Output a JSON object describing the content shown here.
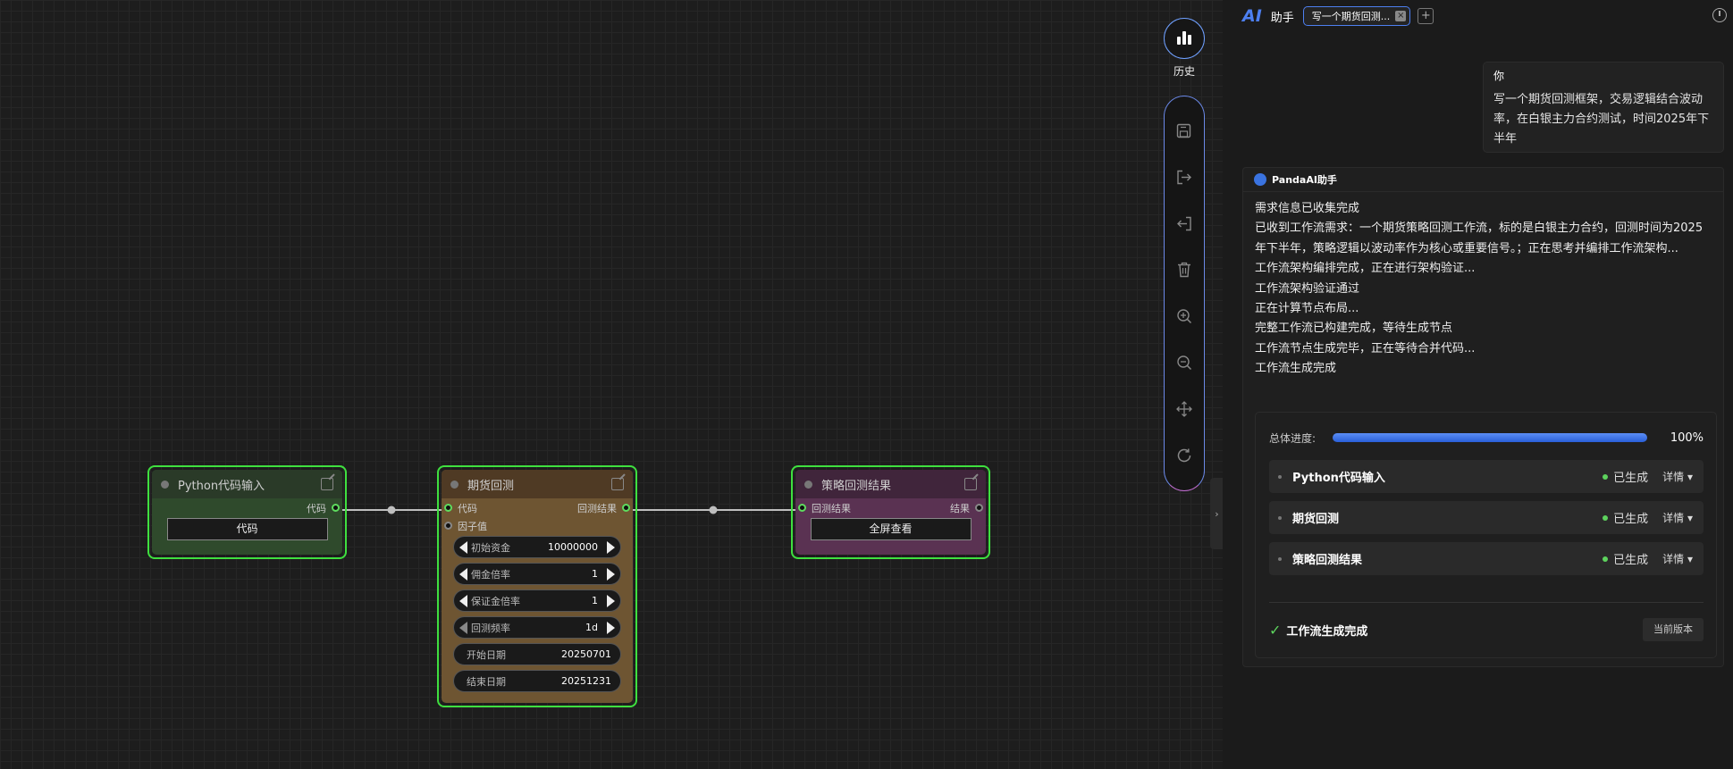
{
  "toolbar": {
    "history_label": "历史",
    "tools": [
      "save-icon",
      "export-icon",
      "import-icon",
      "delete-icon",
      "zoom-in-icon",
      "zoom-out-icon",
      "move-icon",
      "refresh-icon"
    ],
    "collapse_glyph": "›"
  },
  "nodes": {
    "python": {
      "title": "Python代码输入",
      "out_label": "代码",
      "button": "代码"
    },
    "backtest": {
      "title": "期货回测",
      "in_code": "代码",
      "in_factor": "因子值",
      "out_label": "回测结果",
      "params": [
        {
          "name": "初始资金",
          "value": "10000000"
        },
        {
          "name": "佣金倍率",
          "value": "1"
        },
        {
          "name": "保证金倍率",
          "value": "1"
        },
        {
          "name": "回测频率",
          "value": "1d"
        }
      ],
      "dates": [
        {
          "name": "开始日期",
          "value": "20250701"
        },
        {
          "name": "结束日期",
          "value": "20251231"
        }
      ]
    },
    "result": {
      "title": "策略回测结果",
      "in_label": "回测结果",
      "out_label": "结果",
      "button": "全屏查看"
    }
  },
  "panel": {
    "logo": "AI",
    "name": "助手",
    "tab_label": "写一个期货回测...",
    "tab_close": "×",
    "tab_add": "+",
    "user": {
      "who": "你",
      "message": "写一个期货回测框架，交易逻辑结合波动率，在白银主力合约测试，时间2025年下半年"
    },
    "bot": {
      "name": "PandaAI助手",
      "lines": [
        "需求信息已收集完成",
        "已收到工作流需求：一个期货策略回测工作流，标的是白银主力合约，回测时间为2025年下半年，策略逻辑以波动率作为核心或重要信号。；正在思考并编排工作流架构...",
        "工作流架构编排完成，正在进行架构验证...",
        "工作流架构验证通过",
        "正在计算节点布局...",
        "完整工作流已构建完成，等待生成节点",
        "工作流节点生成完毕，正在等待合并代码...",
        "工作流生成完成"
      ],
      "progress_label": "总体进度:",
      "progress_value": 1.0,
      "progress_text": "100%",
      "steps": [
        {
          "name": "Python代码输入",
          "status": "已生成",
          "detail": "详情 ▾"
        },
        {
          "name": "期货回测",
          "status": "已生成",
          "detail": "详情 ▾"
        },
        {
          "name": "策略回测结果",
          "status": "已生成",
          "detail": "详情 ▾"
        }
      ],
      "done_check": "✓",
      "done_text": "工作流生成完成",
      "version_button": "当前版本"
    }
  },
  "colors": {
    "accent": "#4d7ff0",
    "node_border": "#3fe03f",
    "python_node": "#2f4a2c",
    "backtest_node": "#6e5532",
    "result_node": "#5a3252",
    "status_green": "#5dd35d"
  }
}
